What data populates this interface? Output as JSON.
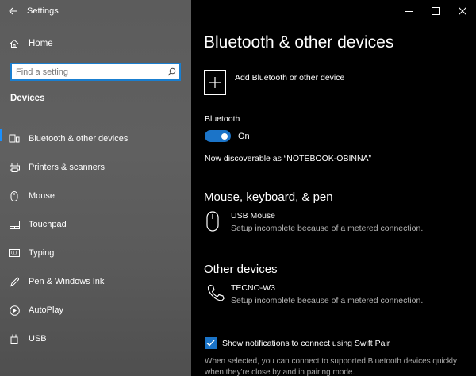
{
  "window": {
    "title": "Settings"
  },
  "sidebar": {
    "home_label": "Home",
    "search": {
      "placeholder": "Find a setting"
    },
    "section_label": "Devices",
    "items": [
      {
        "label": "Bluetooth & other devices",
        "icon": "bluetooth-devices-icon",
        "active": true
      },
      {
        "label": "Printers & scanners",
        "icon": "printer-icon"
      },
      {
        "label": "Mouse",
        "icon": "mouse-icon"
      },
      {
        "label": "Touchpad",
        "icon": "touchpad-icon"
      },
      {
        "label": "Typing",
        "icon": "keyboard-icon"
      },
      {
        "label": "Pen & Windows Ink",
        "icon": "pen-icon"
      },
      {
        "label": "AutoPlay",
        "icon": "autoplay-icon"
      },
      {
        "label": "USB",
        "icon": "usb-icon"
      }
    ]
  },
  "main": {
    "title": "Bluetooth & other devices",
    "add_device_label": "Add Bluetooth or other device",
    "bluetooth": {
      "label": "Bluetooth",
      "state_label": "On",
      "enabled": true
    },
    "discoverable_text": "Now discoverable as “NOTEBOOK-OBINNA”",
    "mouse_section": {
      "heading": "Mouse, keyboard, & pen",
      "devices": [
        {
          "name": "USB Mouse",
          "status": "Setup incomplete because of a metered connection."
        }
      ]
    },
    "other_section": {
      "heading": "Other devices",
      "devices": [
        {
          "name": "TECNO-W3",
          "status": "Setup incomplete because of a metered connection."
        }
      ]
    },
    "swift_pair": {
      "label": "Show notifications to connect using Swift Pair",
      "checked": true,
      "description": "When selected, you can connect to supported Bluetooth devices quickly when they're close by and in pairing mode."
    }
  },
  "colors": {
    "accent": "#1b74c8",
    "sidebar_bg": "#5c5c5c",
    "main_bg": "#000000"
  }
}
